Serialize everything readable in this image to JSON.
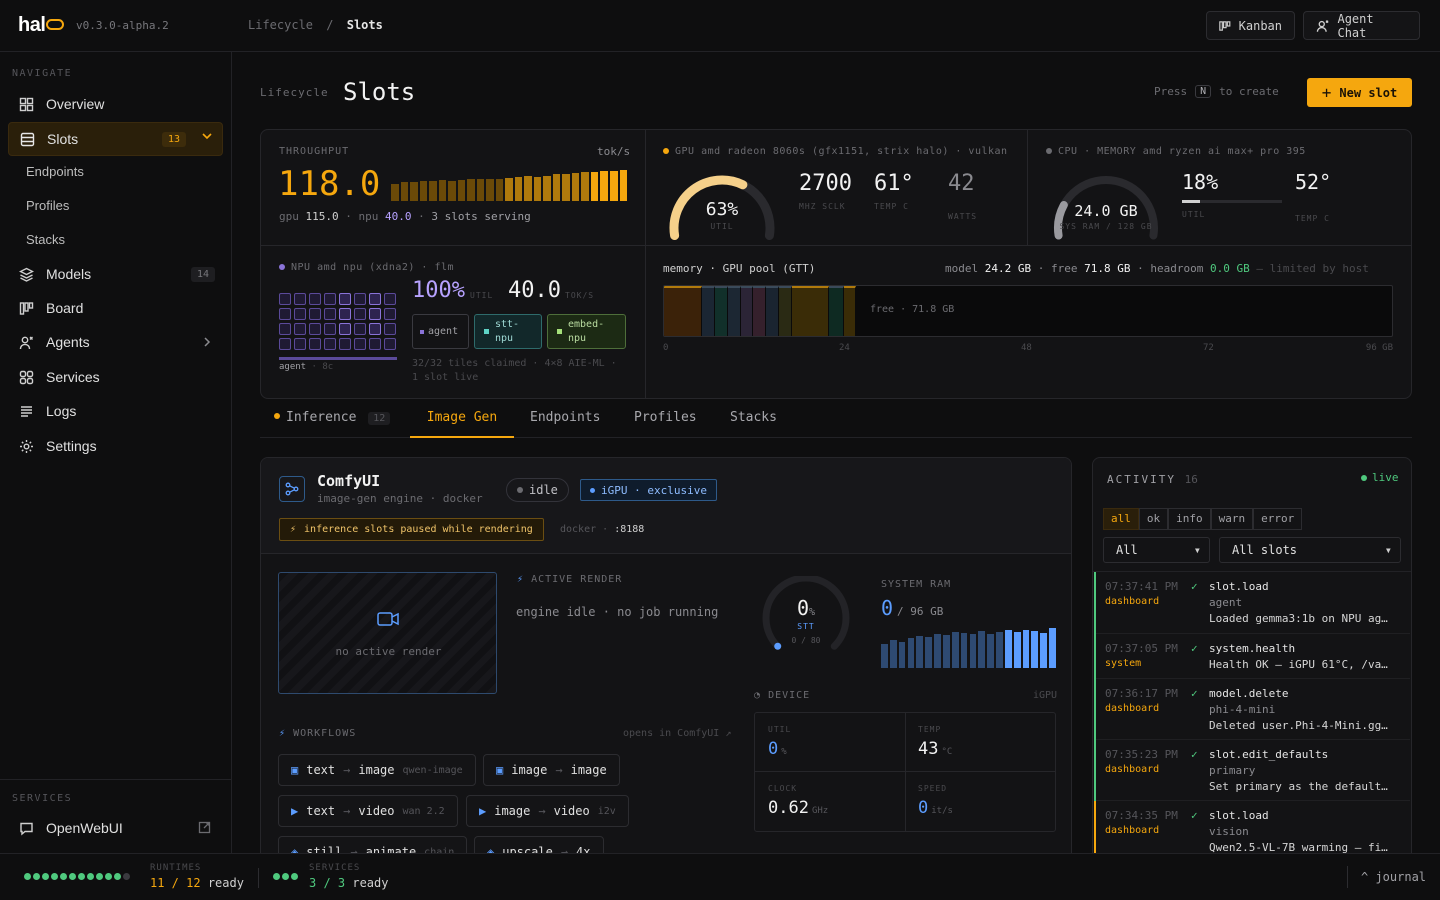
{
  "header": {
    "logo": "hal",
    "version": "v0.3.0-alpha.2",
    "breadcrumb_parent": "Lifecycle",
    "breadcrumb_sep": "/",
    "breadcrumb_current": "Slots",
    "kanban_label": "Kanban",
    "agent_chat_label": "Agent Chat"
  },
  "sidebar": {
    "navigate_header": "NAVIGATE",
    "items": [
      {
        "label": "Overview",
        "icon": "overview-icon"
      },
      {
        "label": "Slots",
        "badge": "13",
        "icon": "slots-icon",
        "active": true
      },
      {
        "label": "Models",
        "badge": "14",
        "icon": "models-icon"
      },
      {
        "label": "Board",
        "icon": "board-icon"
      },
      {
        "label": "Agents",
        "icon": "agents-icon"
      },
      {
        "label": "Services",
        "icon": "services-icon"
      },
      {
        "label": "Logs",
        "icon": "logs-icon"
      },
      {
        "label": "Settings",
        "icon": "settings-icon"
      }
    ],
    "subitems": [
      "Endpoints",
      "Profiles",
      "Stacks"
    ],
    "services_header": "SERVICES",
    "service_link": "OpenWebUI"
  },
  "page": {
    "section": "Lifecycle",
    "title": "Slots",
    "hint_press": "Press",
    "hint_key": "N",
    "hint_rest": "to create",
    "new_slot": "New slot"
  },
  "throughput": {
    "label": "THROUGHPUT",
    "unit": "tok/s",
    "value": "118.0",
    "gpu_label": "gpu",
    "gpu_value": "115.0",
    "npu_label": "npu",
    "npu_value": "40.0",
    "serving": "3 slots serving",
    "bars": [
      0.55,
      0.6,
      0.62,
      0.64,
      0.66,
      0.68,
      0.66,
      0.68,
      0.7,
      0.72,
      0.7,
      0.72,
      0.74,
      0.76,
      0.8,
      0.78,
      0.82,
      0.86,
      0.88,
      0.9,
      0.92,
      0.94,
      0.96,
      0.98,
      1.0
    ]
  },
  "gpu": {
    "label": "GPU",
    "name": "amd radeon 8060s (gfx1151, strix halo) · vulkan",
    "util": "63%",
    "util_frac": 0.63,
    "util_label": "UTIL",
    "sclk": "2700",
    "sclk_label": "MHZ SCLK",
    "temp": "61°",
    "temp_label": "TEMP C",
    "watts": "42",
    "watts_label": "WATTS"
  },
  "cpu": {
    "label": "CPU · MEMORY",
    "name": "amd ryzen ai max+ pro 395",
    "ram": "24.0 GB",
    "ram_frac": 0.19,
    "ram_label": "SYS RAM / 128 GB",
    "util": "18%",
    "util_frac": 0.18,
    "util_label": "UTIL",
    "temp": "52°",
    "temp_label": "TEMP C"
  },
  "npu": {
    "label": "NPU",
    "name": "amd npu (xdna2) · flm",
    "util": "100%",
    "util_label": "UTIL",
    "toks": "40.0",
    "toks_label": "TOK/S",
    "chip_agent": "agent",
    "chip_stt": "stt-npu",
    "chip_embed": "embed-npu",
    "grid_label": "agent",
    "grid_sub": "8c",
    "tiles": "32/32 tiles claimed · 4×8 AIE-ML ·",
    "live": "1 slot live"
  },
  "memory": {
    "title": "memory · GPU pool (GTT)",
    "model_label": "model",
    "model_value": "24.2 GB",
    "free_label": "free",
    "free_value": "71.8 GB",
    "headroom_label": "headroom",
    "headroom_value": "0.0 GB",
    "limit_note": "— limited by host",
    "free_bar_label": "free · 71.8 GB",
    "axis": [
      "0",
      "24",
      "48",
      "72",
      "96 GB"
    ],
    "segments": [
      {
        "gb": 5.0,
        "color": "#3b2209"
      },
      {
        "gb": 1.7,
        "color": "#1b2633"
      },
      {
        "gb": 1.7,
        "color": "#11302a"
      },
      {
        "gb": 1.7,
        "color": "#1c2733"
      },
      {
        "gb": 1.7,
        "color": "#2b2436"
      },
      {
        "gb": 1.7,
        "color": "#35202c"
      },
      {
        "gb": 1.7,
        "color": "#1a2430"
      },
      {
        "gb": 1.7,
        "color": "#2a2a14"
      },
      {
        "gb": 4.9,
        "color": "#3a2c07"
      },
      {
        "gb": 1.9,
        "color": "#0e2a22"
      },
      {
        "gb": 1.6,
        "color": "#3a2c07"
      }
    ],
    "total_gb": 96
  },
  "tabs": [
    {
      "label": "Inference",
      "badge": "12"
    },
    {
      "label": "Image Gen"
    },
    {
      "label": "Endpoints"
    },
    {
      "label": "Profiles"
    },
    {
      "label": "Stacks"
    }
  ],
  "comfy": {
    "title": "ComfyUI",
    "subtitle": "image-gen engine · docker",
    "status": "idle",
    "igpu": "iGPU · exclusive",
    "paused_note": "inference slots paused while rendering",
    "docker_label": "docker ·",
    "port": ":8188",
    "no_render": "no active render",
    "active_render_label": "ACTIVE RENDER",
    "engine_idle": "engine idle · no job running",
    "stt_value": "0",
    "stt_pct": "%",
    "stt_label": "STT",
    "stt_sub": "0 / 80",
    "sysram_label": "SYSTEM RAM",
    "sysram_value": "0",
    "sysram_total": "/ 96 GB",
    "ram_bars": [
      0.6,
      0.7,
      0.65,
      0.75,
      0.8,
      0.78,
      0.85,
      0.82,
      0.9,
      0.88,
      0.84,
      0.92,
      0.86,
      0.9,
      0.94,
      0.9,
      0.96,
      0.92,
      0.88,
      1.0,
      0.96,
      0.9,
      0.98,
      1.0,
      0.94,
      0.92,
      0.96,
      0.9,
      0.98,
      1.0,
      0.94
    ],
    "device_label": "DEVICE",
    "device_tag": "iGPU",
    "dev_util_label": "UTIL",
    "dev_util": "0",
    "dev_util_unit": "%",
    "dev_temp_label": "TEMP",
    "dev_temp": "43",
    "dev_temp_unit": "°C",
    "dev_clock_label": "CLOCK",
    "dev_clock": "0.62",
    "dev_clock_unit": "GHz",
    "dev_speed_label": "SPEED",
    "dev_speed": "0",
    "dev_speed_unit": "it/s",
    "workflows_label": "WORKFLOWS",
    "opens_in": "opens in ComfyUI ↗",
    "workflows": [
      {
        "a": "text",
        "b": "image",
        "sub": "qwen-image"
      },
      {
        "a": "image",
        "b": "image",
        "sub": ""
      },
      {
        "a": "text",
        "b": "video",
        "sub": "wan 2.2"
      },
      {
        "a": "image",
        "b": "video",
        "sub": "i2v"
      },
      {
        "a": "still",
        "b": "animate",
        "sub": "chain"
      },
      {
        "a": "upscale",
        "b": "4x",
        "sub": ""
      }
    ]
  },
  "activity": {
    "title": "ACTIVITY",
    "count": "16",
    "live": "live",
    "filters": [
      "all",
      "ok",
      "info",
      "warn",
      "error"
    ],
    "level_select": "All",
    "slot_select": "All slots",
    "events": [
      {
        "time": "07:37:41 PM",
        "source": "dashboard",
        "event": "slot.load",
        "sub": "agent",
        "msg": "Loaded gemma3:1b on NPU ag…",
        "src_color": "#f5a70e",
        "bar": "#4fc97e"
      },
      {
        "time": "07:37:05 PM",
        "source": "system",
        "event": "system.health",
        "sub": "",
        "msg": "Health OK — iGPU 61°C, /va…",
        "src_color": "#f5a70e",
        "bar": "#4fc97e"
      },
      {
        "time": "07:36:17 PM",
        "source": "dashboard",
        "event": "model.delete",
        "sub": "phi-4-mini",
        "msg": "Deleted user.Phi-4-Mini.gg…",
        "src_color": "#f5a70e",
        "bar": "#4fc97e"
      },
      {
        "time": "07:35:23 PM",
        "source": "dashboard",
        "event": "slot.edit_defaults",
        "sub": "primary",
        "msg": "Set primary as the default…",
        "src_color": "#f5a70e",
        "bar": "#4fc97e"
      },
      {
        "time": "07:34:35 PM",
        "source": "dashboard",
        "event": "slot.load",
        "sub": "vision",
        "msg": "Qwen2.5-VL-7B warming — fi…",
        "src_color": "#f5a70e",
        "bar": "#f5a70e"
      }
    ]
  },
  "footer": {
    "runtimes_label": "RUNTIMES",
    "runtimes_value": "11 / 12",
    "runtimes_ready": "ready",
    "services_label": "SERVICES",
    "services_value": "3 / 3",
    "services_ready": "ready",
    "journal": "^ journal"
  },
  "colors": {
    "accent": "#f5a70e",
    "npu": "#b7a2ff",
    "ok": "#4fc97e",
    "blue": "#5c9dff"
  }
}
